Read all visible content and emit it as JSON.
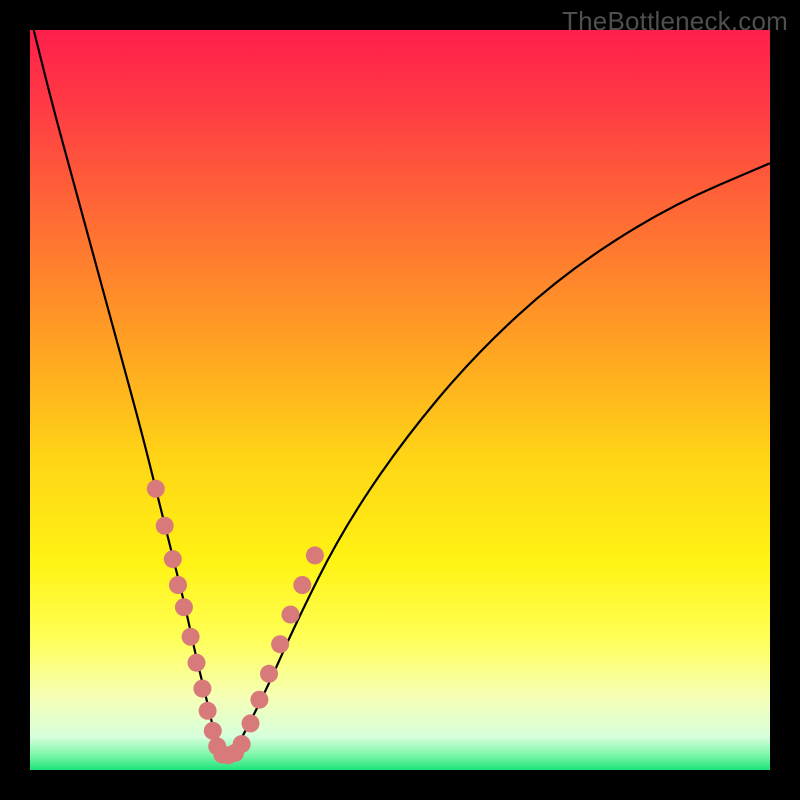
{
  "watermark": "TheBottleneck.com",
  "chart_data": {
    "type": "line",
    "title": "",
    "xlabel": "",
    "ylabel": "",
    "xlim": [
      0,
      100
    ],
    "ylim": [
      0,
      100
    ],
    "background": {
      "gradient_stops": [
        {
          "offset": 0.0,
          "color": "#ff1f4b"
        },
        {
          "offset": 0.1,
          "color": "#ff3a44"
        },
        {
          "offset": 0.25,
          "color": "#ff6a35"
        },
        {
          "offset": 0.42,
          "color": "#ffa023"
        },
        {
          "offset": 0.58,
          "color": "#ffd516"
        },
        {
          "offset": 0.72,
          "color": "#fff314"
        },
        {
          "offset": 0.82,
          "color": "#ffff55"
        },
        {
          "offset": 0.9,
          "color": "#f6ffb4"
        },
        {
          "offset": 0.955,
          "color": "#d7ffdc"
        },
        {
          "offset": 0.98,
          "color": "#7cf7a8"
        },
        {
          "offset": 1.0,
          "color": "#1de37a"
        }
      ]
    },
    "series": [
      {
        "name": "bottleneck-curve",
        "x": [
          0.5,
          3,
          6,
          9,
          12,
          15,
          17,
          19,
          21,
          22.5,
          24,
          25,
          25.7,
          26.5,
          27.5,
          29,
          32,
          36,
          42,
          50,
          60,
          72,
          86,
          100
        ],
        "y": [
          100,
          90,
          79,
          68,
          57,
          46,
          38,
          30,
          22,
          15,
          9,
          4.5,
          2,
          2,
          2.5,
          5,
          11,
          20,
          32,
          44,
          56,
          67,
          76,
          82
        ]
      }
    ],
    "markers": {
      "name": "highlighted-points",
      "color": "#d87a7a",
      "points": [
        {
          "x": 17.0,
          "y": 38
        },
        {
          "x": 18.2,
          "y": 33
        },
        {
          "x": 19.3,
          "y": 28.5
        },
        {
          "x": 20.0,
          "y": 25
        },
        {
          "x": 20.8,
          "y": 22
        },
        {
          "x": 21.7,
          "y": 18
        },
        {
          "x": 22.5,
          "y": 14.5
        },
        {
          "x": 23.3,
          "y": 11
        },
        {
          "x": 24.0,
          "y": 8
        },
        {
          "x": 24.7,
          "y": 5.3
        },
        {
          "x": 25.3,
          "y": 3.2
        },
        {
          "x": 26.0,
          "y": 2.1
        },
        {
          "x": 26.8,
          "y": 2.0
        },
        {
          "x": 27.7,
          "y": 2.3
        },
        {
          "x": 28.6,
          "y": 3.5
        },
        {
          "x": 29.8,
          "y": 6.3
        },
        {
          "x": 31.0,
          "y": 9.5
        },
        {
          "x": 32.3,
          "y": 13.0
        },
        {
          "x": 33.8,
          "y": 17.0
        },
        {
          "x": 35.2,
          "y": 21.0
        },
        {
          "x": 36.8,
          "y": 25.0
        },
        {
          "x": 38.5,
          "y": 29.0
        }
      ]
    }
  }
}
